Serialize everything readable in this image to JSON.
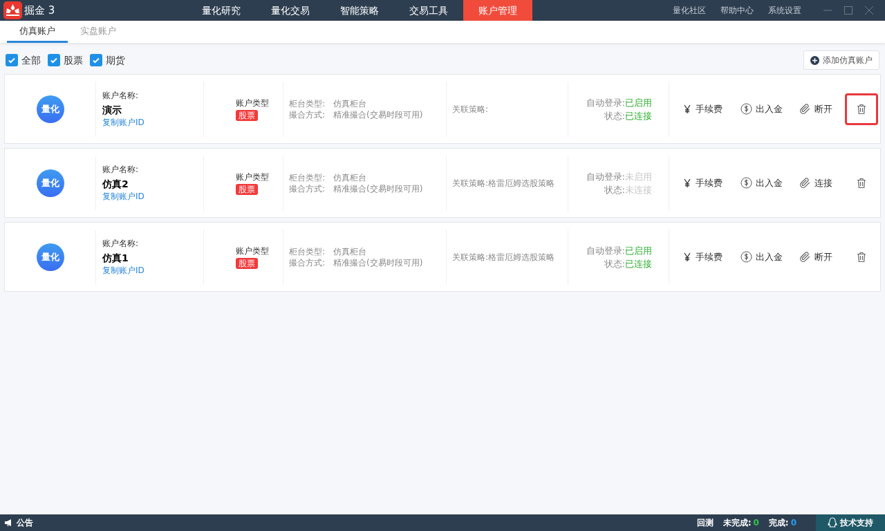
{
  "app": {
    "name": "掘金 3"
  },
  "nav": [
    {
      "label": "量化研究",
      "selected": false
    },
    {
      "label": "量化交易",
      "selected": false
    },
    {
      "label": "智能策略",
      "selected": false
    },
    {
      "label": "交易工具",
      "selected": false
    },
    {
      "label": "账户管理",
      "selected": true
    }
  ],
  "top_links": [
    "量化社区",
    "帮助中心",
    "系统设置"
  ],
  "tabs": [
    {
      "label": "仿真账户",
      "selected": true
    },
    {
      "label": "实盘账户",
      "selected": false
    }
  ],
  "filters": [
    {
      "label": "全部",
      "checked": true
    },
    {
      "label": "股票",
      "checked": true
    },
    {
      "label": "期货",
      "checked": true
    }
  ],
  "add_button": "添加仿真账户",
  "accounts": [
    {
      "avatar": "量化",
      "name_label": "账户名称:",
      "name": "演示",
      "copy_link": "复制账户ID",
      "type_label": "账户类型",
      "type": "股票",
      "counter_label": "柜台类型:",
      "counter": "仿真柜台",
      "match_label": "撮合方式:",
      "match": "精准撮合(交易时段可用)",
      "strategy_label": "关联策略:",
      "auto_login_label": "自动登录:",
      "auto_login": "已启用",
      "auto_login_on": true,
      "status_label": "状态:",
      "status": "已连接",
      "connected": true,
      "fee": "手续费",
      "funds": "出入金",
      "connect_action": "断开",
      "highlighted": true
    },
    {
      "avatar": "量化",
      "name_label": "账户名称:",
      "name": "仿真2",
      "copy_link": "复制账户ID",
      "type_label": "账户类型",
      "type": "股票",
      "counter_label": "柜台类型:",
      "counter": "仿真柜台",
      "match_label": "撮合方式:",
      "match": "精准撮合(交易时段可用)",
      "strategy_label": "关联策略:",
      "strategy": "格雷厄姆选股策略",
      "auto_login_label": "自动登录:",
      "auto_login": "未启用",
      "auto_login_on": false,
      "status_label": "状态:",
      "status": "未连接",
      "connected": false,
      "fee": "手续费",
      "funds": "出入金",
      "connect_action": "连接",
      "highlighted": false
    },
    {
      "avatar": "量化",
      "name_label": "账户名称:",
      "name": "仿真1",
      "copy_link": "复制账户ID",
      "type_label": "账户类型",
      "type": "股票",
      "counter_label": "柜台类型:",
      "counter": "仿真柜台",
      "match_label": "撮合方式:",
      "match": "精准撮合(交易时段可用)",
      "strategy_label": "关联策略:",
      "strategy": "格雷厄姆选股策略",
      "auto_login_label": "自动登录:",
      "auto_login": "已启用",
      "auto_login_on": true,
      "status_label": "状态:",
      "status": "已连接",
      "connected": true,
      "fee": "手续费",
      "funds": "出入金",
      "connect_action": "断开",
      "highlighted": false
    }
  ],
  "status_bar": {
    "notice": "公告",
    "backtest": "回测",
    "pending_label": "未完成:",
    "pending": "0",
    "done_label": "完成:",
    "done": "0",
    "support": "技术支持"
  }
}
